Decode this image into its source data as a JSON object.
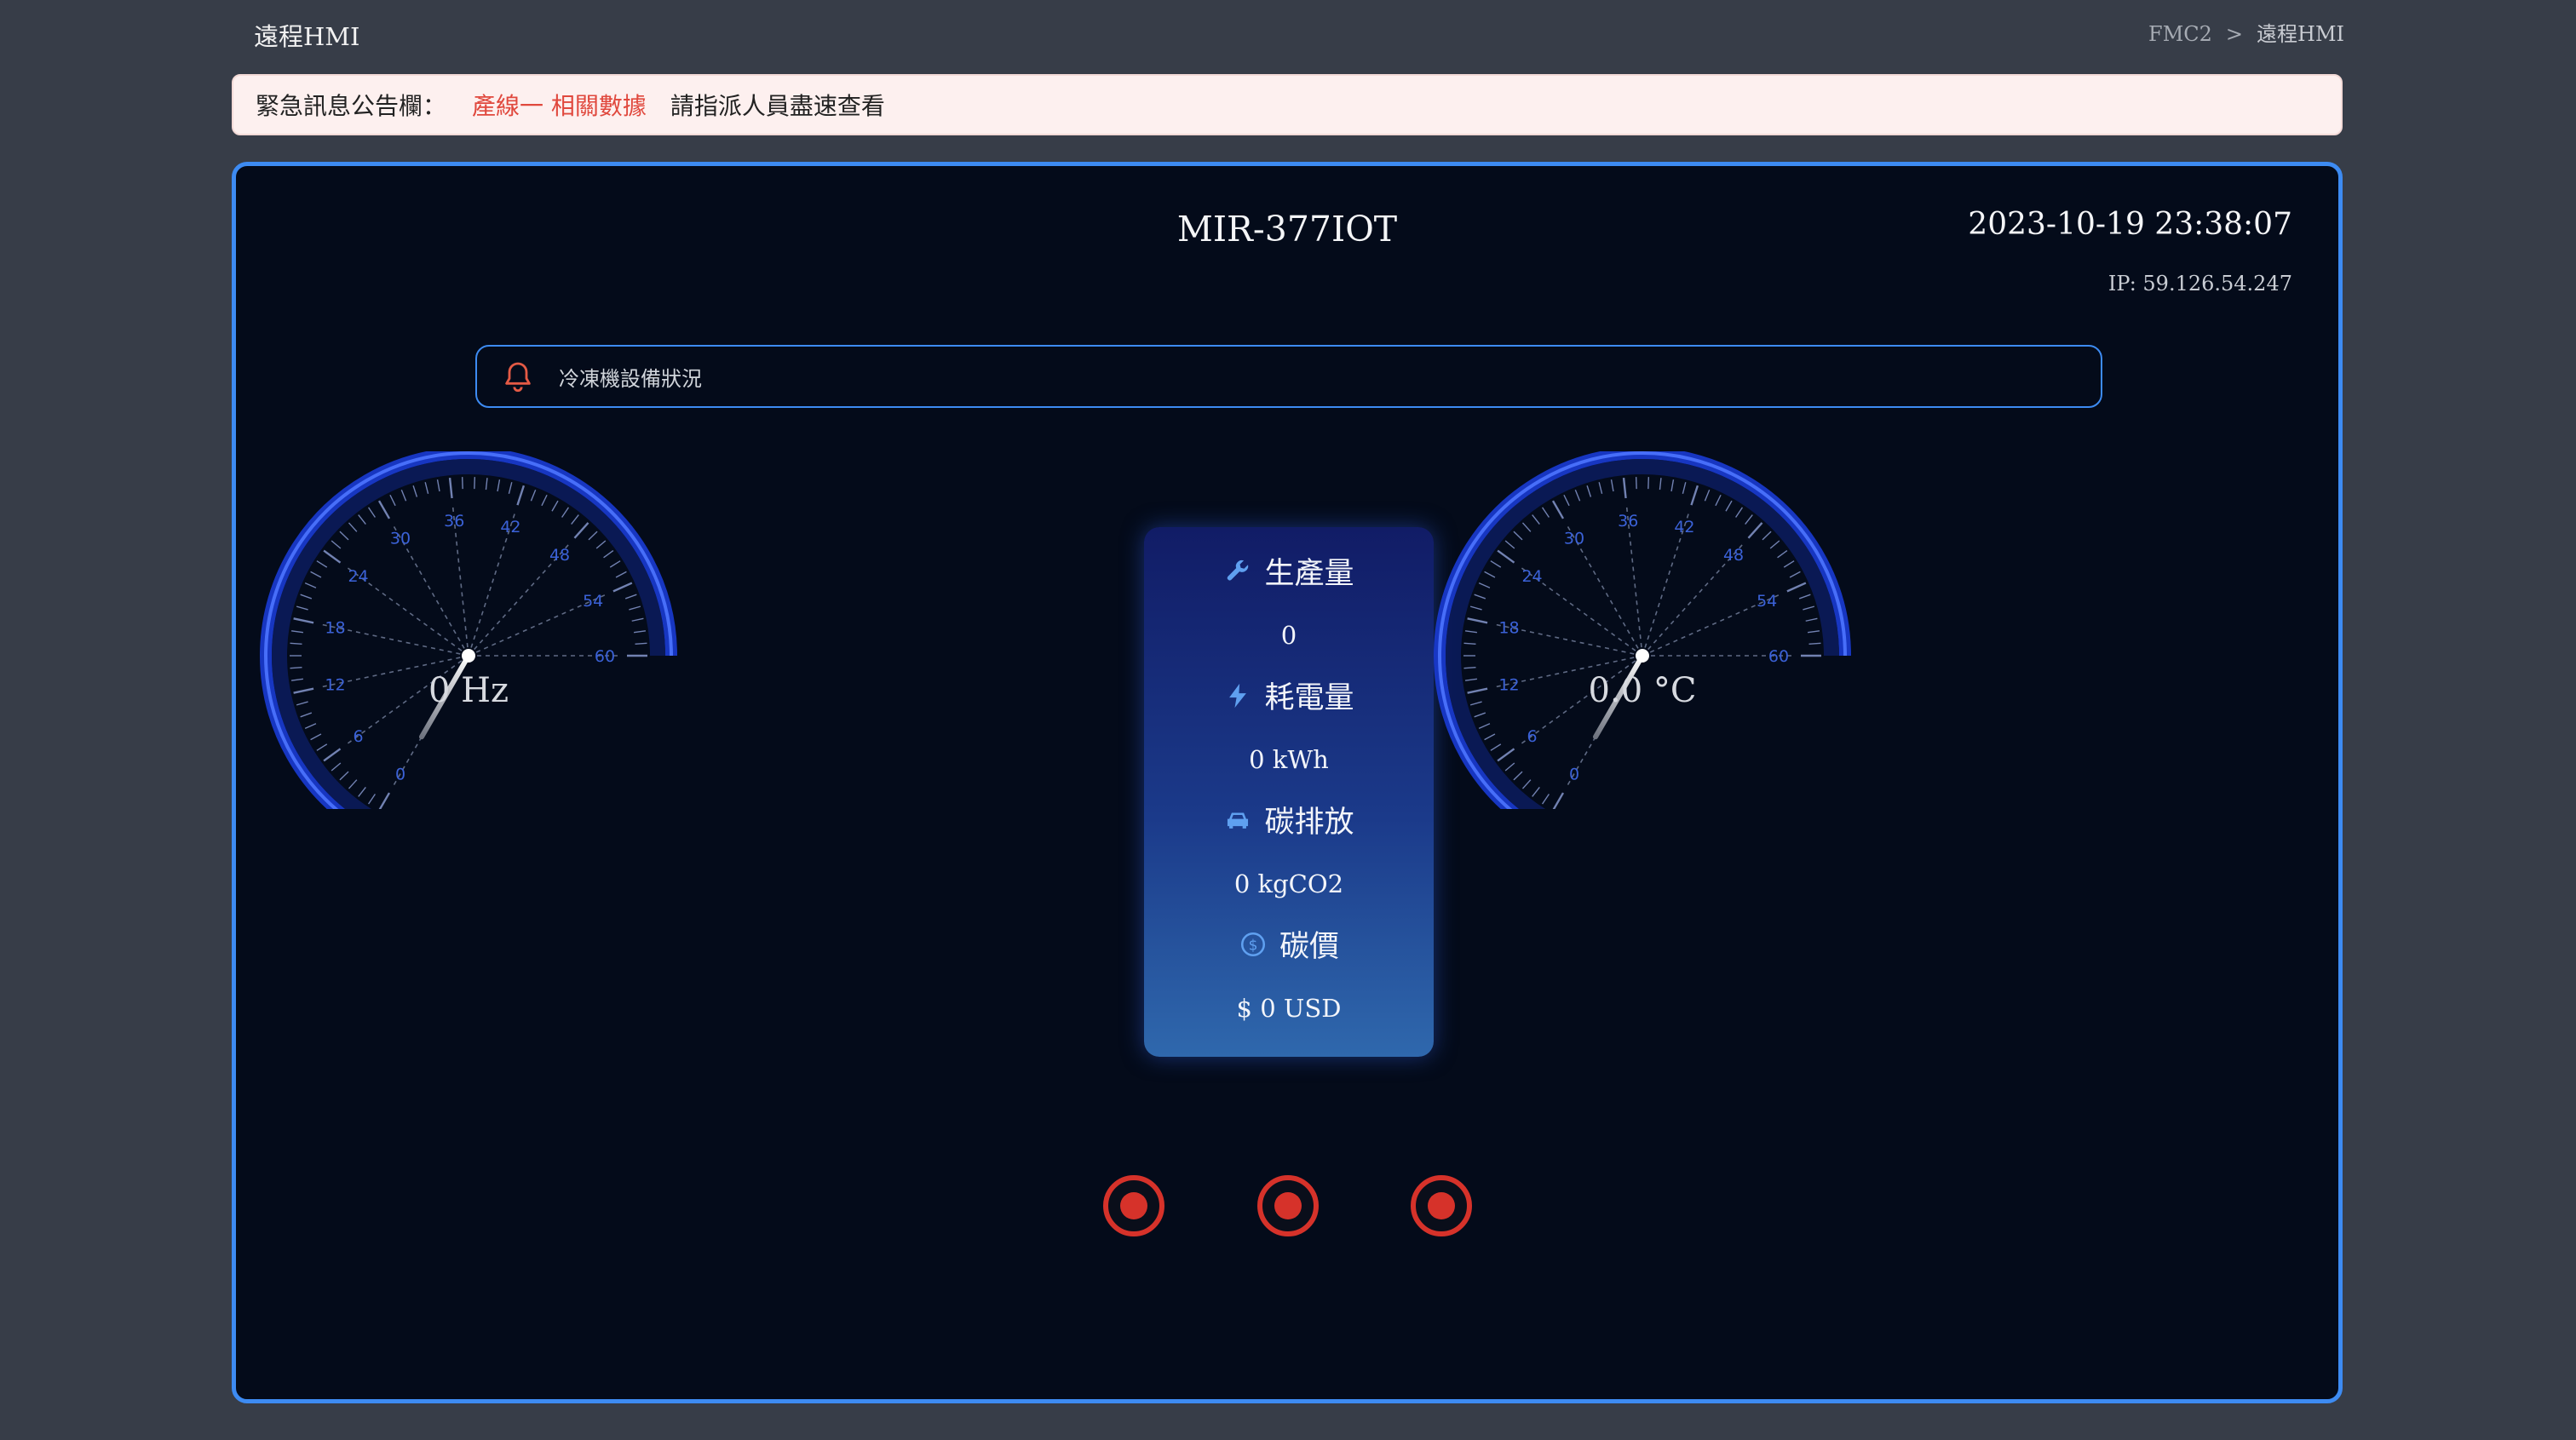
{
  "app": {
    "title": "遠程HMI"
  },
  "breadcrumb": {
    "parent": "FMC2",
    "separator": ">",
    "current": "遠程HMI"
  },
  "notice": {
    "label": "緊急訊息公告欄：",
    "highlight": "產線一 相關數據",
    "message": "請指派人員盡速查看"
  },
  "device": {
    "name": "MIR-377IOT",
    "datetime": "2023-10-19 23:38:07",
    "ip": "IP: 59.126.54.247"
  },
  "status_bar": {
    "icon": "bell-icon",
    "text": "冷凍機設備狀況"
  },
  "gauges": [
    {
      "name": "frequency-gauge",
      "ticks": [
        "0",
        "6",
        "12",
        "18",
        "24",
        "30",
        "36",
        "42",
        "48",
        "54",
        "60"
      ],
      "value": 0,
      "readout": "0 Hz"
    },
    {
      "name": "temperature-gauge",
      "ticks": [
        "0",
        "6",
        "12",
        "18",
        "24",
        "30",
        "36",
        "42",
        "48",
        "54",
        "60"
      ],
      "value": 0,
      "readout": "0.0 °C"
    }
  ],
  "stats": {
    "production": {
      "icon": "wrench-icon",
      "label": "生產量",
      "value": "0"
    },
    "power": {
      "icon": "lightning-icon",
      "label": "耗電量",
      "value": "0 kWh"
    },
    "carbon": {
      "icon": "car-icon",
      "label": "碳排放",
      "value": "0 kgCO2"
    },
    "price": {
      "icon": "dollar-circle-icon",
      "label": "碳價",
      "value": "$ 0 USD"
    }
  },
  "indicators": [
    {
      "status": "off",
      "color": "#d6322a"
    },
    {
      "status": "off",
      "color": "#d6322a"
    },
    {
      "status": "off",
      "color": "#d6322a"
    }
  ],
  "colors": {
    "accent": "#3d8bf2",
    "alert": "#e0483d",
    "indicator": "#d6322a",
    "panel_bg": "#040b1a",
    "page_bg": "#373d48"
  }
}
